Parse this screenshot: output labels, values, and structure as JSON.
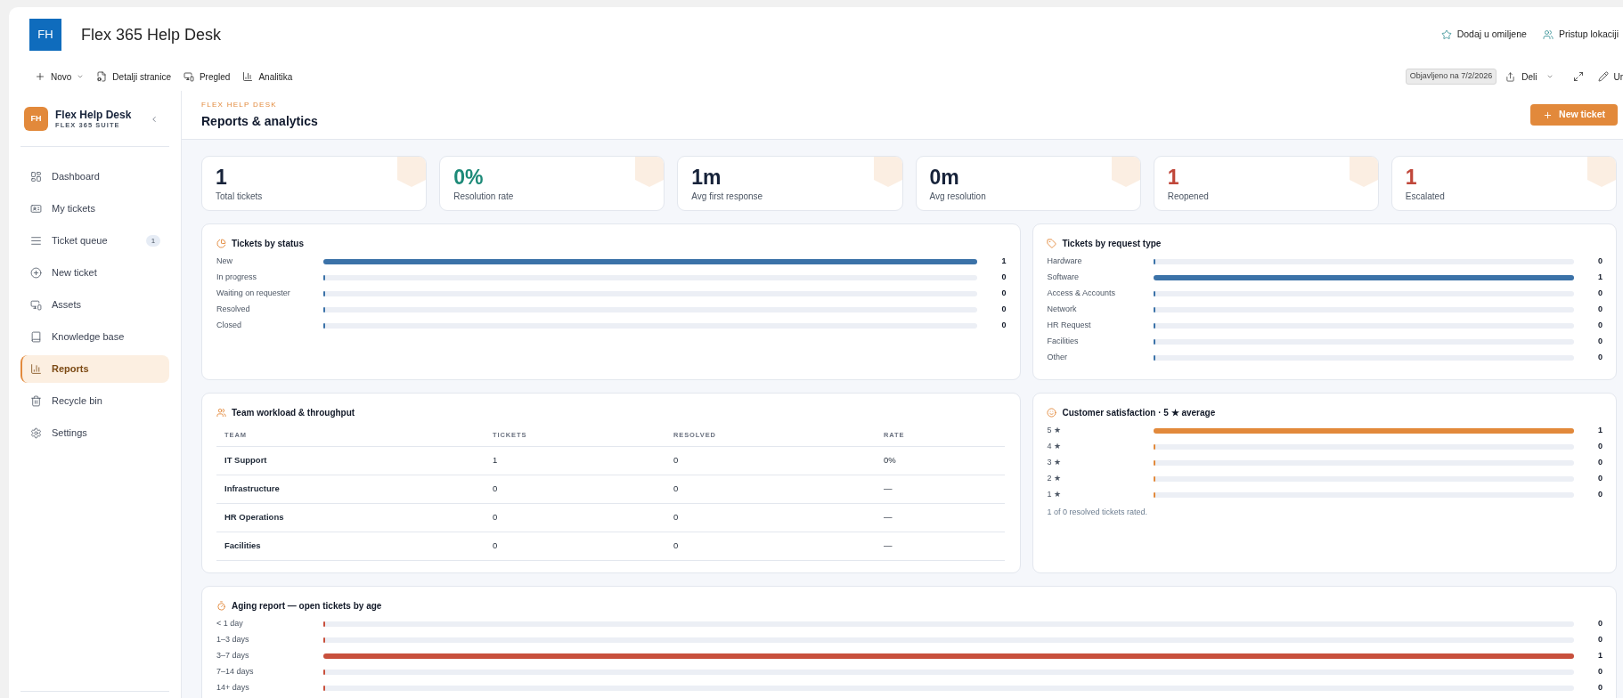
{
  "site": {
    "logo": "FH",
    "title": "Flex 365 Help Desk",
    "actions": [
      {
        "label": "Dodaj u omiljene"
      },
      {
        "label": "Pristup lokaciji"
      }
    ]
  },
  "command_bar": {
    "items": [
      {
        "label": "Novo",
        "dropdown": true
      },
      {
        "label": "Detalji stranice",
        "dropdown": false
      },
      {
        "label": "Pregled",
        "dropdown": false
      },
      {
        "label": "Analitika",
        "dropdown": false
      }
    ],
    "published": "Objavljeno na 7/2/2026",
    "share": {
      "label": "Deli",
      "dropdown": true
    },
    "edit": {
      "label": "Ur"
    }
  },
  "sidebar": {
    "logo": "FH",
    "title": "Flex Help Desk",
    "subtitle": "FLEX 365 SUITE",
    "items": [
      {
        "label": "Dashboard",
        "selected": false
      },
      {
        "label": "My tickets",
        "selected": false
      },
      {
        "label": "Ticket queue",
        "badge": "1",
        "selected": false
      },
      {
        "label": "New ticket",
        "selected": false
      },
      {
        "label": "Assets",
        "selected": false
      },
      {
        "label": "Knowledge base",
        "selected": false
      },
      {
        "label": "Reports",
        "selected": true
      },
      {
        "label": "Recycle bin",
        "selected": false
      },
      {
        "label": "Settings",
        "selected": false
      }
    ]
  },
  "header": {
    "eyebrow": "FLEX HELP DESK",
    "title": "Reports & analytics",
    "button": "New ticket"
  },
  "kpis": [
    {
      "value": "1",
      "label": "Total tickets",
      "color": "#17233a"
    },
    {
      "value": "0%",
      "label": "Resolution rate",
      "color": "#1d8a78"
    },
    {
      "value": "1m",
      "label": "Avg first response",
      "color": "#17233a"
    },
    {
      "value": "0m",
      "label": "Avg resolution",
      "color": "#17233a"
    },
    {
      "value": "1",
      "label": "Reopened",
      "color": "#c0473a"
    },
    {
      "value": "1",
      "label": "Escalated",
      "color": "#c0473a"
    }
  ],
  "status_panel": {
    "title": "Tickets by status",
    "rows": [
      {
        "label": "New",
        "level": 1,
        "count": "1"
      },
      {
        "label": "In progress",
        "level": 0,
        "count": "0"
      },
      {
        "label": "Waiting on requester",
        "level": 0,
        "count": "0"
      },
      {
        "label": "Resolved",
        "level": 0,
        "count": "0"
      },
      {
        "label": "Closed",
        "level": 0,
        "count": "0"
      }
    ]
  },
  "request_type_panel": {
    "title": "Tickets by request type",
    "rows": [
      {
        "label": "Hardware",
        "level": 0,
        "count": "0"
      },
      {
        "label": "Software",
        "level": 1,
        "count": "1"
      },
      {
        "label": "Access & Accounts",
        "level": 0,
        "count": "0"
      },
      {
        "label": "Network",
        "level": 0,
        "count": "0"
      },
      {
        "label": "HR Request",
        "level": 0,
        "count": "0"
      },
      {
        "label": "Facilities",
        "level": 0,
        "count": "0"
      },
      {
        "label": "Other",
        "level": 0,
        "count": "0"
      }
    ]
  },
  "team_panel": {
    "title": "Team workload & throughput",
    "columns": [
      "TEAM",
      "TICKETS",
      "RESOLVED",
      "RATE"
    ],
    "rows": [
      [
        "IT Support",
        "1",
        "0",
        "0%"
      ],
      [
        "Infrastructure",
        "0",
        "0",
        "—"
      ],
      [
        "HR Operations",
        "0",
        "0",
        "—"
      ],
      [
        "Facilities",
        "0",
        "0",
        "—"
      ]
    ]
  },
  "satisfaction_panel": {
    "title": "Customer satisfaction · 5 ★ average",
    "rows": [
      {
        "label": "5 ★",
        "level": 1,
        "count": "1"
      },
      {
        "label": "4 ★",
        "level": 0,
        "count": "0"
      },
      {
        "label": "3 ★",
        "level": 0,
        "count": "0"
      },
      {
        "label": "2 ★",
        "level": 0,
        "count": "0"
      },
      {
        "label": "1 ★",
        "level": 0,
        "count": "0"
      }
    ],
    "note": "1 of 0 resolved tickets rated."
  },
  "aging_panel": {
    "title": "Aging report — open tickets by age",
    "rows": [
      {
        "label": "< 1 day",
        "level": 0,
        "count": "0"
      },
      {
        "label": "1–3 days",
        "level": 0,
        "count": "0"
      },
      {
        "label": "3–7 days",
        "level": 1,
        "count": "1"
      },
      {
        "label": "7–14 days",
        "level": 0,
        "count": "0"
      },
      {
        "label": "14+ days",
        "level": 0,
        "count": "0"
      }
    ]
  }
}
